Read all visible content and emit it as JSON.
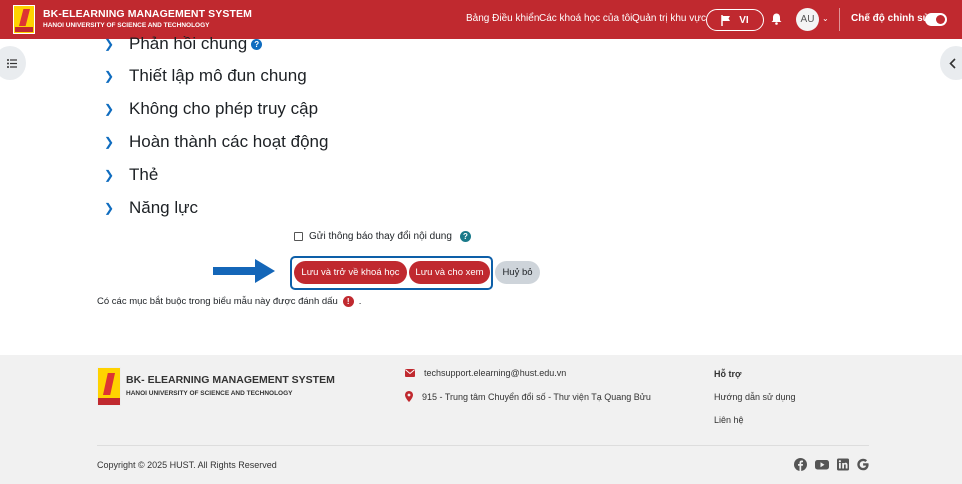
{
  "navbar": {
    "brand_title": "BK-ELEARNING MANAGEMENT SYSTEM",
    "brand_subtitle": "HANOI UNIVERSITY OF SCIENCE AND TECHNOLOGY",
    "links": [
      "Bảng Điều khiển",
      "Các khoá học của tôi",
      "Quản trị khu vực"
    ],
    "language": "VI",
    "avatar_initials": "AU",
    "edit_mode_label": "Chế độ chỉnh sửa",
    "accent_color": "#c0292f"
  },
  "sections": [
    {
      "title": "Phản hồi chung",
      "has_help": true
    },
    {
      "title": "Thiết lập mô đun chung"
    },
    {
      "title": "Không cho phép truy cập"
    },
    {
      "title": "Hoàn thành các hoạt động"
    },
    {
      "title": "Thẻ"
    },
    {
      "title": "Năng lực"
    }
  ],
  "notify_label": "Gửi thông báo thay đổi nội dung",
  "buttons": {
    "save_return": "Lưu và trở về khoá học",
    "save_display": "Lưu và cho xem",
    "cancel": "Huỷ bỏ"
  },
  "required_note": {
    "before": "Có các mục bắt buộc trong biểu mẫu này được đánh dấu",
    "after": "."
  },
  "footer": {
    "brand_title": "BK- ELEARNING MANAGEMENT SYSTEM",
    "brand_subtitle": "HANOI UNIVERSITY OF SCIENCE AND TECHNOLOGY",
    "email": "techsupport.elearning@hust.edu.vn",
    "address": "915 - Trung tâm Chuyển đổi số - Thư viện Tạ Quang Bửu",
    "support_heading": "Hỗ trợ",
    "guide": "Hướng dẫn sử dụng",
    "contact": "Liên hệ",
    "copyright": "Copyright © 2025 HUST. All Rights Reserved",
    "social": [
      "facebook-icon",
      "youtube-icon",
      "linkedin-icon",
      "google-icon"
    ]
  }
}
